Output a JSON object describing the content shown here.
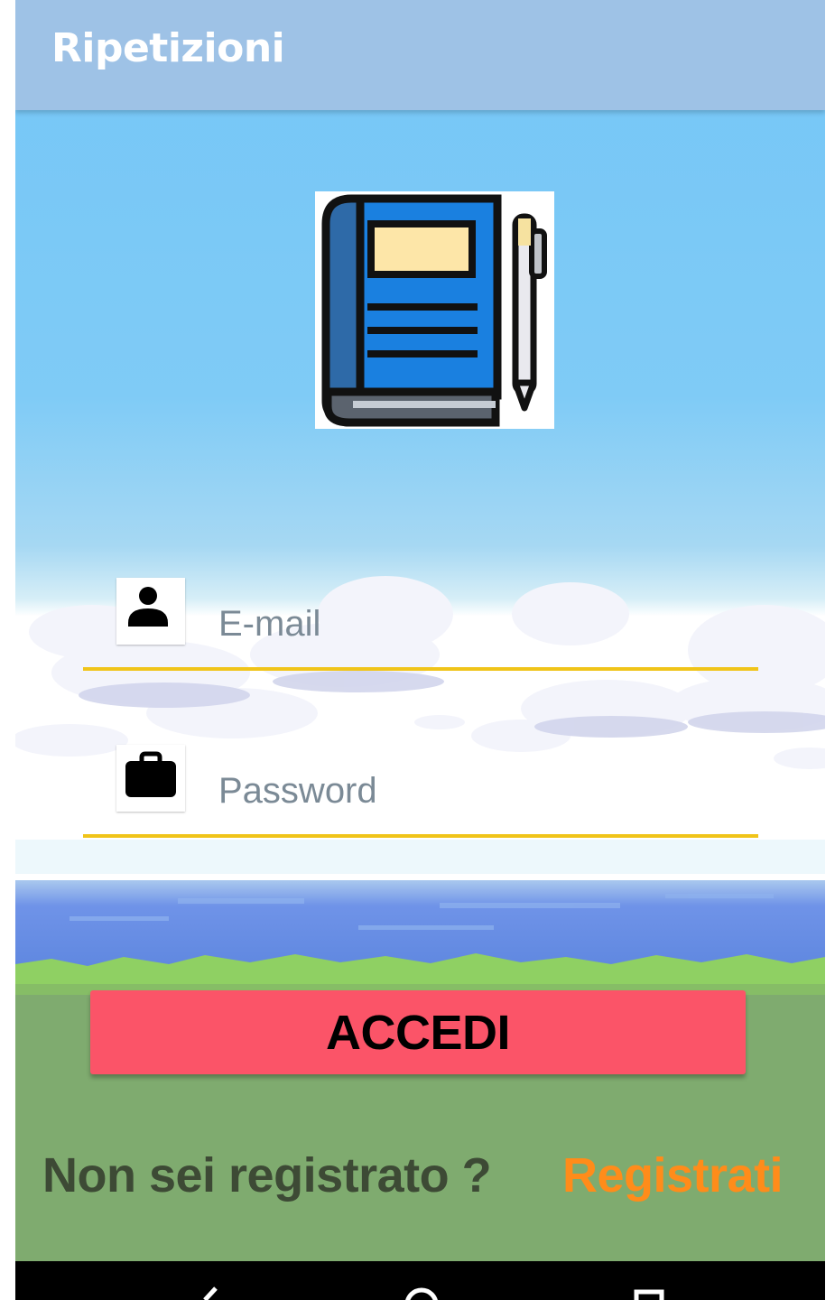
{
  "appbar": {
    "title": "Ripetizioni"
  },
  "login_form": {
    "email_placeholder": "E-mail",
    "email_value": "",
    "password_placeholder": "Password",
    "password_value": "",
    "submit_label": "ACCEDI"
  },
  "register": {
    "prompt": "Non sei registrato ?",
    "link_label": "Registrati"
  },
  "icons": {
    "logo": "notebook-with-pen-icon",
    "email": "person-icon",
    "password": "briefcase-icon",
    "nav": [
      "back-icon",
      "home-icon",
      "recents-icon"
    ]
  },
  "colors": {
    "appbar": "#9ec2e6",
    "sky": "#75c6f7",
    "field_underline": "#f0c419",
    "button": "#fb5468",
    "register_link": "#ff8c1a",
    "prompt_text": "#3d4a35",
    "grass": "#7fab6f"
  }
}
